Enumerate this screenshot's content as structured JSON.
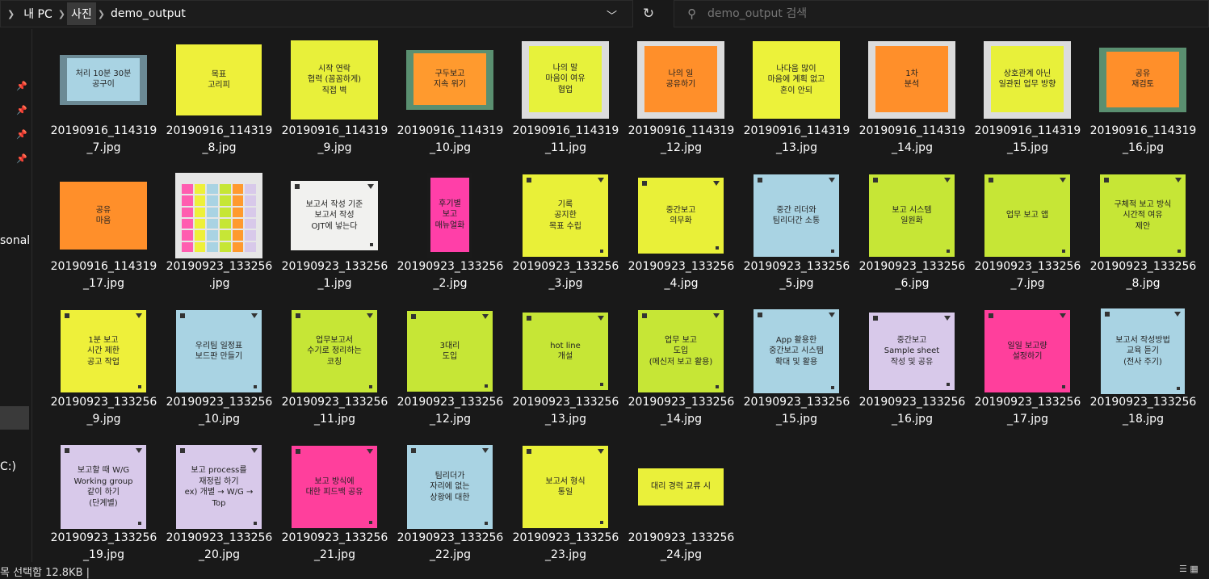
{
  "address": {
    "crumbs": [
      "내 PC",
      "사진",
      "demo_output"
    ],
    "dropdown_glyph": "﹀",
    "refresh_glyph": "↻"
  },
  "search": {
    "placeholder": "demo_output 검색"
  },
  "sidebar": {
    "label_personal": "sonal",
    "label_drive": "C:)"
  },
  "status": {
    "text": "목 선택함 12.8KB  |"
  },
  "files": [
    {
      "name": "20190916_114319_7.jpg",
      "bg": "#a9d3e3",
      "text": "처리 10분 30분\n공구이",
      "w": 108,
      "h": 62,
      "photo": "#6b8a95"
    },
    {
      "name": "20190916_114319_8.jpg",
      "bg": "#eef03a",
      "text": "목표\n고리피",
      "w": 106,
      "h": 88
    },
    {
      "name": "20190916_114319_9.jpg",
      "bg": "#e8f03a",
      "text": "시작 연락\n협력 (꼼꼼하게)\n직접 벽",
      "w": 108,
      "h": 98
    },
    {
      "name": "20190916_114319_10.jpg",
      "bg": "#ff9a2e",
      "text": "구두보고\n지속 위기",
      "w": 108,
      "h": 74,
      "photo": "#5a8f70"
    },
    {
      "name": "20190916_114319_11.jpg",
      "bg": "#e7f23b",
      "text": "나의 말\n마음이 여유\n협업",
      "w": 108,
      "h": 96,
      "photo": "#dcdcdc"
    },
    {
      "name": "20190916_114319_12.jpg",
      "bg": "#ff8f2a",
      "text": "나의 일\n공유하기",
      "w": 108,
      "h": 96,
      "photo": "#dcdcdc"
    },
    {
      "name": "20190916_114319_13.jpg",
      "bg": "#ecf23a",
      "text": "나다움 많이\n마음에 계획 없고\n혼이 안되",
      "w": 108,
      "h": 96
    },
    {
      "name": "20190916_114319_14.jpg",
      "bg": "#ff8f2a",
      "text": "1차\n분석",
      "w": 108,
      "h": 96,
      "photo": "#dcdcdc"
    },
    {
      "name": "20190916_114319_15.jpg",
      "bg": "#e8f03a",
      "text": "상호관계 아닌\n일관된 업무 방향",
      "w": 108,
      "h": 96,
      "photo": "#dcdcdc"
    },
    {
      "name": "20190916_114319_16.jpg",
      "bg": "#ff8f2a",
      "text": "공유\n재검토",
      "w": 108,
      "h": 80,
      "photo": "#5a8f70"
    },
    {
      "name": "20190916_114319_17.jpg",
      "bg": "#ff8f2a",
      "text": "공유\n마음",
      "w": 108,
      "h": 84
    },
    {
      "name": "20190923_133256.jpg",
      "bg": "#cfd4d6",
      "text": "",
      "w": 108,
      "h": 106,
      "grid": true
    },
    {
      "name": "20190923_133256_1.jpg",
      "bg": "#f1f1ef",
      "text": "보고서 작성 기준\n보고서 작성\nOJT에 넣는다",
      "w": 108,
      "h": 86
    },
    {
      "name": "20190923_133256_2.jpg",
      "bg": "#ff3fa8",
      "text": "후기별\n보고\n매뉴얼화",
      "w": 56,
      "h": 106,
      "photo": "#1a1a1a"
    },
    {
      "name": "20190923_133256_3.jpg",
      "bg": "#e9f038",
      "text": "기록\n공지한\n목표 수립",
      "w": 106,
      "h": 102
    },
    {
      "name": "20190923_133256_4.jpg",
      "bg": "#e9f038",
      "text": "중간보고\n의무화",
      "w": 106,
      "h": 94
    },
    {
      "name": "20190923_133256_5.jpg",
      "bg": "#a9d3e3",
      "text": "중간 리더와\n팀리더간 소통",
      "w": 106,
      "h": 102
    },
    {
      "name": "20190923_133256_6.jpg",
      "bg": "#c6e636",
      "text": "보고 시스템\n일원화",
      "w": 106,
      "h": 102
    },
    {
      "name": "20190923_133256_7.jpg",
      "bg": "#c6e636",
      "text": "업무 보고 앱",
      "w": 106,
      "h": 102
    },
    {
      "name": "20190923_133256_8.jpg",
      "bg": "#c6e636",
      "text": "구체적 보고 방식\n시간적 여유\n제안",
      "w": 106,
      "h": 102
    },
    {
      "name": "20190923_133256_9.jpg",
      "bg": "#eef03a",
      "text": "1분 보고\n시간 제한\n공고 작업",
      "w": 106,
      "h": 102
    },
    {
      "name": "20190923_133256_10.jpg",
      "bg": "#a9d3e3",
      "text": "우리팀 일정표\n보드판 만들기",
      "w": 106,
      "h": 102
    },
    {
      "name": "20190923_133256_11.jpg",
      "bg": "#c6e636",
      "text": "업무보고서\n수기로 정리하는\n코칭",
      "w": 106,
      "h": 102
    },
    {
      "name": "20190923_133256_12.jpg",
      "bg": "#c6e636",
      "text": "3대리\n도입",
      "w": 106,
      "h": 100
    },
    {
      "name": "20190923_133256_13.jpg",
      "bg": "#c6e636",
      "text": "hot line\n개설",
      "w": 106,
      "h": 96
    },
    {
      "name": "20190923_133256_14.jpg",
      "bg": "#c6e636",
      "text": "업무 보고\n도입\n(메신저 보고 활용)",
      "w": 106,
      "h": 102
    },
    {
      "name": "20190923_133256_15.jpg",
      "bg": "#a9d3e3",
      "text": "App 활용한\n중간보고 시스템\n확대 및 활용",
      "w": 106,
      "h": 104
    },
    {
      "name": "20190923_133256_16.jpg",
      "bg": "#d8c9ea",
      "text": "중간보고\nSample sheet\n작성 및 공유",
      "w": 106,
      "h": 96
    },
    {
      "name": "20190923_133256_17.jpg",
      "bg": "#ff3f9c",
      "text": "일일 보고량\n설정하기",
      "w": 106,
      "h": 102
    },
    {
      "name": "20190923_133256_18.jpg",
      "bg": "#a9d3e3",
      "text": "보고서 작성방법\n교육 듣기\n(전사 주기)",
      "w": 104,
      "h": 106
    },
    {
      "name": "20190923_133256_19.jpg",
      "bg": "#d8c9ea",
      "text": "보고할 때 W/G\nWorking group\n같이 하기\n(단계별)",
      "w": 106,
      "h": 104
    },
    {
      "name": "20190923_133256_20.jpg",
      "bg": "#d8c9ea",
      "text": "보고 process를\n재정립 하기\nex) 개별 → W/G → Top",
      "w": 106,
      "h": 104
    },
    {
      "name": "20190923_133256_21.jpg",
      "bg": "#ff3f9c",
      "text": "보고 방식에\n대한 피드백 공유",
      "w": 106,
      "h": 102
    },
    {
      "name": "20190923_133256_22.jpg",
      "bg": "#a9d3e3",
      "text": "팀리더가\n자리에 없는\n상황에 대한",
      "w": 106,
      "h": 104
    },
    {
      "name": "20190923_133256_23.jpg",
      "bg": "#e9f038",
      "text": "보고서 형식\n통일",
      "w": 106,
      "h": 102
    },
    {
      "name": "20190923_133256_24.jpg",
      "bg": "#eaf03a",
      "text": "대리 경력 교류 시",
      "w": 106,
      "h": 46
    }
  ]
}
